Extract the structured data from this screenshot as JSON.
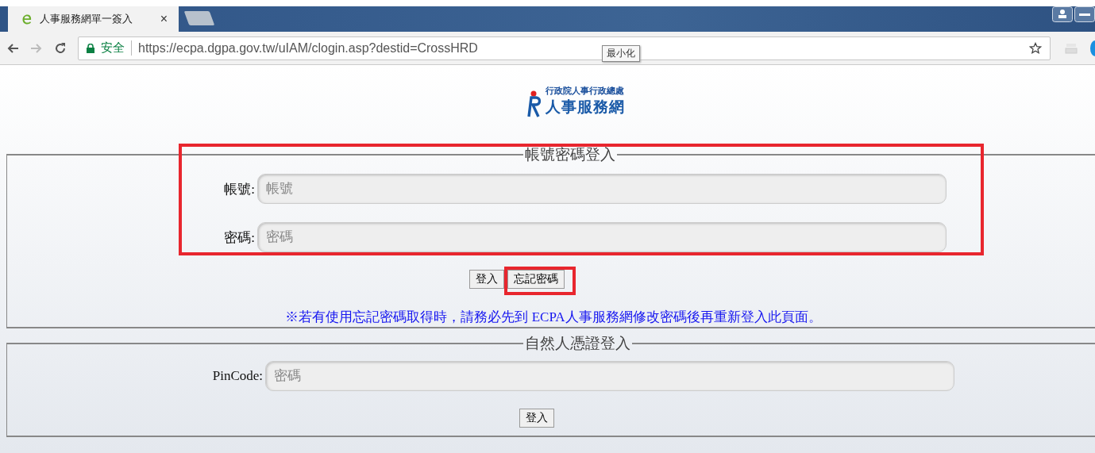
{
  "browser": {
    "tabs": [
      {
        "title": "人事服務網單一簽入",
        "close": "×",
        "selected": true
      }
    ],
    "address": {
      "secure_label": "安全",
      "url": "https://ecpa.dgpa.gov.tw/uIAM/clogin.asp?destid=CrossHRD"
    },
    "tooltip": "最小化"
  },
  "header": {
    "org": "行政院人事行政總處",
    "site": "人事服務網"
  },
  "sections": [
    {
      "legend": "帳號密碼登入",
      "highlighted": true,
      "fields": [
        {
          "label": "帳號:",
          "placeholder": "帳號"
        },
        {
          "label": "密碼:",
          "placeholder": "密碼"
        }
      ],
      "buttons": [
        {
          "label": "登入",
          "highlighted": false
        },
        {
          "label": "忘記密碼",
          "highlighted": true
        }
      ],
      "note": "※若有使用忘記密碼取得時，請務必先到 ECPA人事服務網修改密碼後再重新登入此頁面。"
    },
    {
      "legend": "自然人憑證登入",
      "fields": [
        {
          "label": "PinCode:",
          "placeholder": "密碼"
        }
      ],
      "buttons": [
        {
          "label": "登入",
          "highlighted": false
        }
      ]
    }
  ]
}
